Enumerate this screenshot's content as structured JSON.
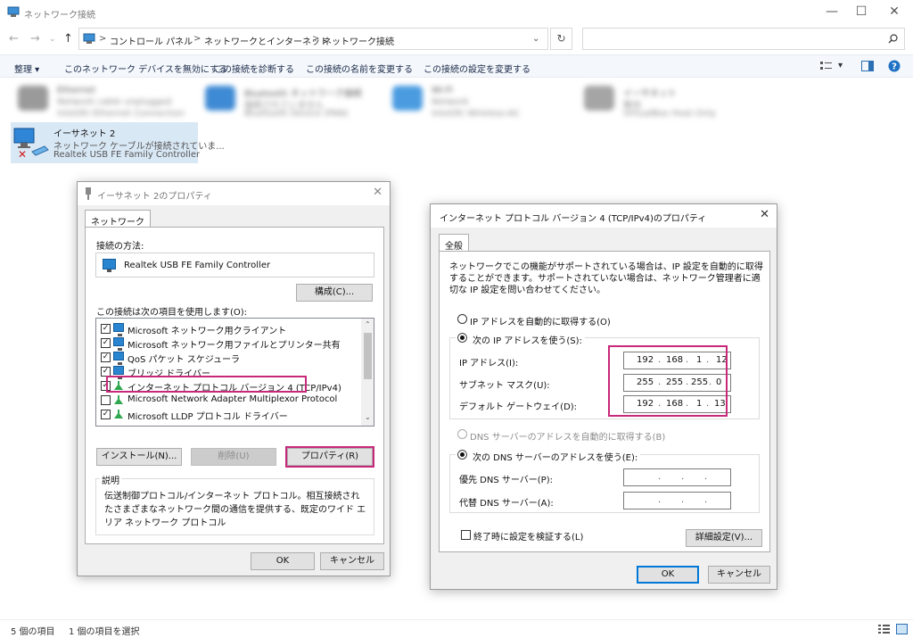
{
  "window": {
    "title": "ネットワーク接続",
    "controls": {
      "minimize": "—",
      "maximize": "☐",
      "close": "✕"
    }
  },
  "address": {
    "crumbs": [
      "コントロール パネル",
      "ネットワークとインターネット",
      "ネットワーク接続"
    ],
    "separator": ">",
    "search_placeholder": ""
  },
  "commands": {
    "organize": "整理 ▾",
    "disable": "このネットワーク デバイスを無効にする",
    "diagnose": "この接続を診断する",
    "rename": "この接続の名前を変更する",
    "settings": "この接続の設定を変更する"
  },
  "connections": {
    "selected": {
      "name": "イーサネット 2",
      "status": "ネットワーク ケーブルが接続されていま...",
      "device": "Realtek USB FE Family Controller"
    },
    "blurred": [
      {
        "name": "Ethernet",
        "status": "Network cable unplugged",
        "device": "Intel(R) Ethernet Connection"
      },
      {
        "name": "Bluetooth ネットワーク接続",
        "status": "接続されていません",
        "device": "Bluetooth Device (PAN)"
      },
      {
        "name": "Wi-Fi",
        "status": "Network",
        "device": "Intel(R) Wireless-AC"
      },
      {
        "name": "イーサネット",
        "status": "無効",
        "device": "VirtualBox Host-Only"
      }
    ]
  },
  "props_dialog": {
    "title": "イーサネット 2のプロパティ",
    "tab": "ネットワーク",
    "connect_using_label": "接続の方法:",
    "adapter": "Realtek USB FE Family Controller",
    "configure": "構成(C)...",
    "items_label": "この接続は次の項目を使用します(O):",
    "items": [
      {
        "label": "Microsoft ネットワーク用クライアント",
        "checked": true
      },
      {
        "label": "Microsoft ネットワーク用ファイルとプリンター共有",
        "checked": true
      },
      {
        "label": "QoS パケット スケジューラ",
        "checked": true
      },
      {
        "label": "ブリッジ ドライバー",
        "checked": true
      },
      {
        "label": "インターネット プロトコル バージョン 4 (TCP/IPv4)",
        "checked": true
      },
      {
        "label": "Microsoft Network Adapter Multiplexor Protocol",
        "checked": false
      },
      {
        "label": "Microsoft LLDP プロトコル ドライバー",
        "checked": true
      }
    ],
    "install": "インストール(N)...",
    "uninstall": "削除(U)",
    "properties": "プロパティ(R)",
    "description_label": "説明",
    "description": "伝送制御プロトコル/インターネット プロトコル。相互接続されたさまざまなネットワーク間の通信を提供する、既定のワイド エリア ネットワーク プロトコル",
    "ok": "OK",
    "cancel": "キャンセル"
  },
  "ipv4_dialog": {
    "title": "インターネット プロトコル バージョン 4 (TCP/IPv4)のプロパティ",
    "tab": "全般",
    "intro": "ネットワークでこの機能がサポートされている場合は、IP 設定を自動的に取得することができます。サポートされていない場合は、ネットワーク管理者に適切な IP 設定を問い合わせてください。",
    "auto_ip": "IP アドレスを自動的に取得する(O)",
    "manual_ip": "次の IP アドレスを使う(S):",
    "ip_label": "IP アドレス(I):",
    "ip": [
      "192",
      "168",
      "1",
      "12"
    ],
    "mask_label": "サブネット マスク(U):",
    "mask": [
      "255",
      "255",
      "255",
      "0"
    ],
    "gateway_label": "デフォルト ゲートウェイ(D):",
    "gateway": [
      "192",
      "168",
      "1",
      "13"
    ],
    "auto_dns": "DNS サーバーのアドレスを自動的に取得する(B)",
    "manual_dns": "次の DNS サーバーのアドレスを使う(E):",
    "pref_dns_label": "優先 DNS サーバー(P):",
    "alt_dns_label": "代替 DNS サーバー(A):",
    "validate": "終了時に設定を検証する(L)",
    "advanced": "詳細設定(V)...",
    "ok": "OK",
    "cancel": "キャンセル"
  },
  "statusbar": {
    "count": "5 個の項目",
    "selected": "1 個の項目を選択"
  },
  "colors": {
    "highlight": "#c8287a",
    "accent": "#0078d7"
  }
}
